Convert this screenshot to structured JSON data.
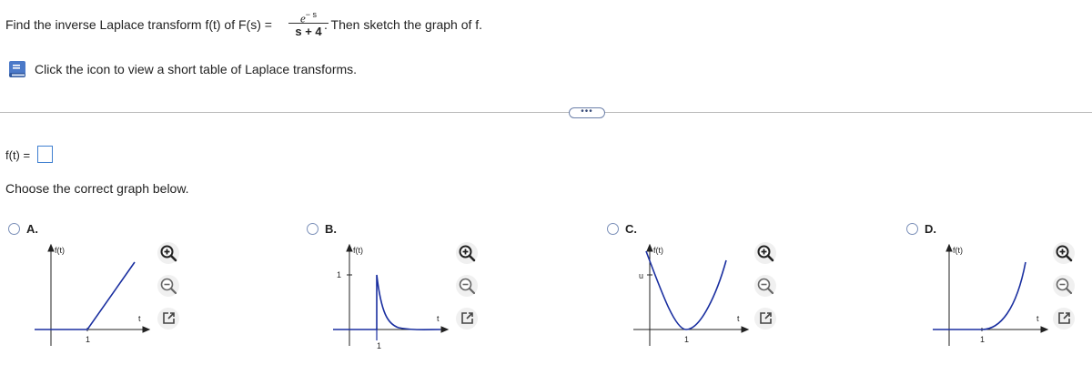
{
  "question": {
    "prefix": "Find the inverse Laplace transform f(t) of F(s) =",
    "numerator_base": "e",
    "numerator_exp": "− s",
    "denominator": "s + 4",
    "suffix": ". Then sketch the graph of f."
  },
  "hint": {
    "text": "Click the icon to view a short table of Laplace transforms."
  },
  "more_button": {
    "label": "•••"
  },
  "answer": {
    "label": "f(t) =",
    "value": ""
  },
  "prompt": {
    "text": "Choose the correct graph below."
  },
  "options": [
    {
      "letter": "A.",
      "y_label": "f(t)",
      "x_label": "t",
      "tick_x": "1",
      "tick_y": ""
    },
    {
      "letter": "B.",
      "y_label": "f(t)",
      "x_label": "t",
      "tick_x": "1",
      "tick_y": "1"
    },
    {
      "letter": "C.",
      "y_label": "f(t)",
      "x_label": "t",
      "tick_x": "1",
      "tick_y": "u"
    },
    {
      "letter": "D.",
      "y_label": "f(t)",
      "x_label": "t",
      "tick_x": "1",
      "tick_y": ""
    }
  ],
  "colors": {
    "curve": "#1a2fa0",
    "axis": "#222222",
    "answer_box": "#3f7fd0",
    "radio": "#7a8fb8"
  },
  "icons": [
    "book-icon",
    "zoom-in-icon",
    "zoom-out-icon",
    "open-window-icon"
  ]
}
